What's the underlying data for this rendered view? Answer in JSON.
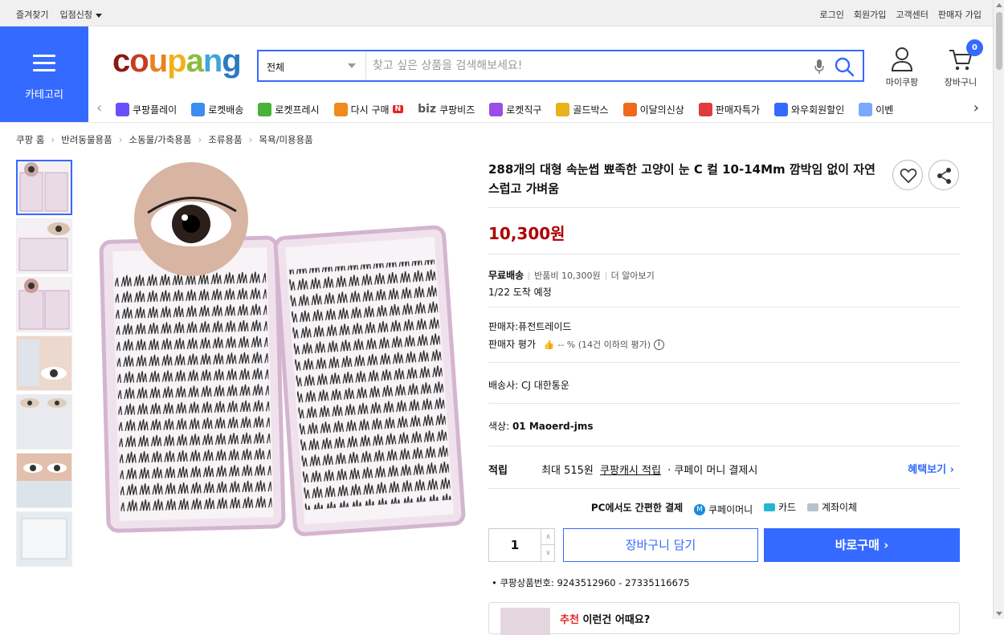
{
  "topbar": {
    "left": [
      "즐겨찾기",
      "입점신청"
    ],
    "right": [
      "로그인",
      "회원가입",
      "고객센터",
      "판매자 가입"
    ]
  },
  "category": {
    "label": "카테고리"
  },
  "logo": "coupang",
  "search": {
    "category": "전체",
    "placeholder": "찾고 싶은 상품을 검색해보세요!"
  },
  "header": {
    "mypage": "마이쿠팡",
    "cart": "장바구니",
    "cart_count": "0"
  },
  "services": [
    {
      "label": "쿠팡플레이",
      "icon": "play-icon",
      "color": "#6c4cff"
    },
    {
      "label": "로켓배송",
      "icon": "rocket-icon",
      "color": "#3d8cf0"
    },
    {
      "label": "로켓프레시",
      "icon": "rocket-fresh-icon",
      "color": "#49b23a"
    },
    {
      "label": "다시 구매",
      "icon": "rebuy-icon",
      "color": "#f08a1c",
      "badge": "N"
    },
    {
      "label": "쿠팡비즈",
      "icon": "biz-icon",
      "color": "#555555",
      "prefix": "biz"
    },
    {
      "label": "로켓직구",
      "icon": "rocket-global-icon",
      "color": "#9b4de6"
    },
    {
      "label": "골드박스",
      "icon": "goldbox-icon",
      "color": "#e8b21a"
    },
    {
      "label": "이달의신상",
      "icon": "new-bag-icon",
      "color": "#f06a1c"
    },
    {
      "label": "판매자특가",
      "icon": "discount-icon",
      "color": "#e23b3b"
    },
    {
      "label": "와우회원할인",
      "icon": "wow-icon",
      "color": "#346aff"
    },
    {
      "label": "이벤",
      "icon": "event-icon",
      "color": "#7aa7ff"
    }
  ],
  "breadcrumb": [
    "쿠팡 홈",
    "반려동물용품",
    "소동물/가축용품",
    "조류용품",
    "목욕/미용용품"
  ],
  "product": {
    "title": "288개의 대형 속눈썹 뾰족한 고양이 눈 C 컬 10-14Mm 깜박임 없이 자연스럽고 가벼움",
    "price": "10,300원",
    "shipping_free": "무료배송",
    "return_fee": "반품비 10,300원",
    "more": "더 알아보기",
    "arrival": "1/22 도착 예정",
    "seller": "판매자:퓨전트레이드",
    "seller_rating_label": "판매자 평가",
    "seller_rating_value": "-- % (14건 이하의 평가)",
    "delivery": "배송사:  CJ 대한통운",
    "color_label": "색상:",
    "color_value": "01 Maoerd-jms",
    "reward_label": "적립",
    "reward_text_1": "최대 515원",
    "reward_link": "쿠팡캐시 적립",
    "reward_text_2": "· 쿠페이 머니 결제시",
    "benefit_link": "혜택보기",
    "pay_line": "PC에서도 간편한 결제",
    "pay_methods": [
      "쿠페이머니",
      "카드",
      "계좌이체"
    ],
    "quantity": "1",
    "cart_button": "장바구니 담기",
    "buy_button": "바로구매",
    "product_id": "쿠팡상품번호: 9243512960 - 27335116675",
    "rec_highlight": "추천",
    "rec_text": "이런건 어때요?"
  },
  "colors": {
    "brand_blue": "#346aff",
    "price_red": "#ae0000"
  }
}
